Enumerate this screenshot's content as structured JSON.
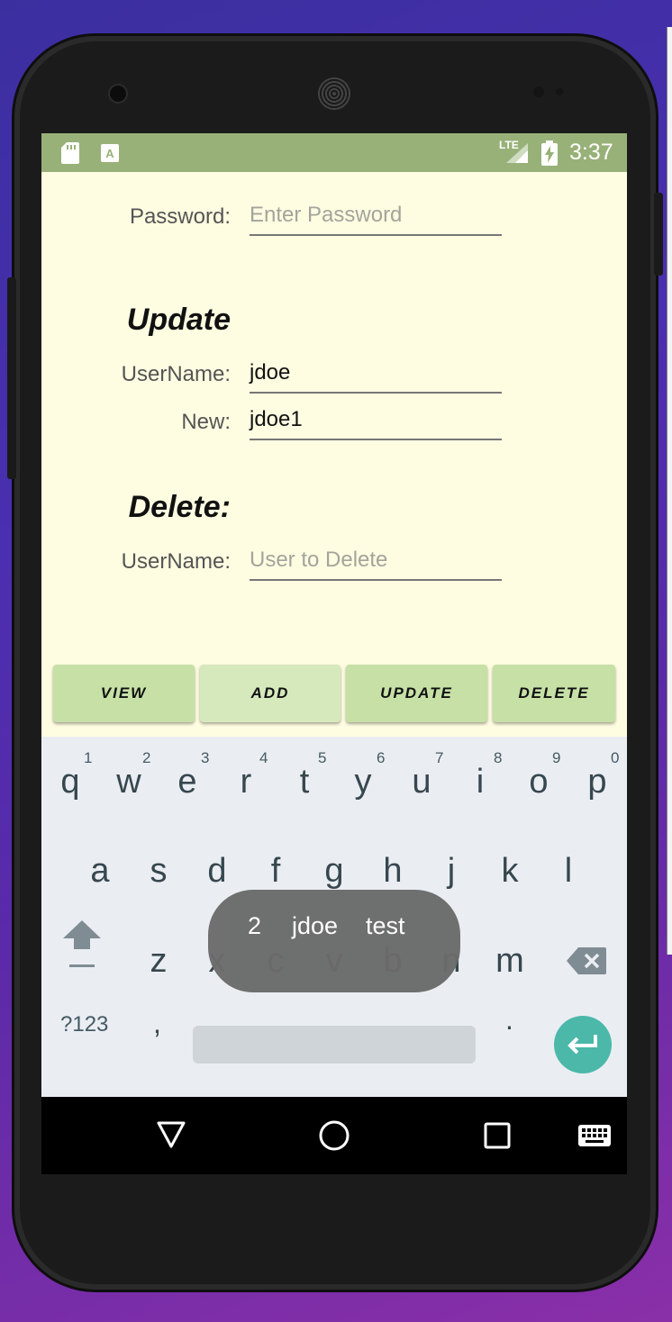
{
  "status_bar": {
    "time": "3:37",
    "network": "LTE",
    "left_icons": [
      "sd-card-icon",
      "a-notification-icon"
    ]
  },
  "form": {
    "password_label": "Password:",
    "password_placeholder": "Enter Password",
    "update_heading": "Update",
    "update_username_label": "UserName:",
    "update_username_value": "jdoe",
    "update_new_label": "New:",
    "update_new_value": "jdoe1",
    "delete_heading": "Delete:",
    "delete_username_label": "UserName:",
    "delete_username_placeholder": "User to Delete"
  },
  "buttons": {
    "view": "VIEW",
    "add": "ADD",
    "update": "UPDATE",
    "delete": "DELETE"
  },
  "keyboard": {
    "row1": [
      "q",
      "w",
      "e",
      "r",
      "t",
      "y",
      "u",
      "i",
      "o",
      "p"
    ],
    "row1_hints": [
      "1",
      "2",
      "3",
      "4",
      "5",
      "6",
      "7",
      "8",
      "9",
      "0"
    ],
    "row2": [
      "a",
      "s",
      "d",
      "f",
      "g",
      "h",
      "j",
      "k",
      "l"
    ],
    "row3": [
      "z",
      "x",
      "c",
      "v",
      "b",
      "n",
      "m"
    ],
    "symbols_key": "?123",
    "comma_key": ",",
    "period_key": ".",
    "suggestions": [
      "2",
      "jdoe",
      "test"
    ]
  },
  "colors": {
    "status_bar": "#98b178",
    "app_background": "#fffde1",
    "button": "#c6e0a6",
    "enter_key": "#4bb8a9"
  }
}
